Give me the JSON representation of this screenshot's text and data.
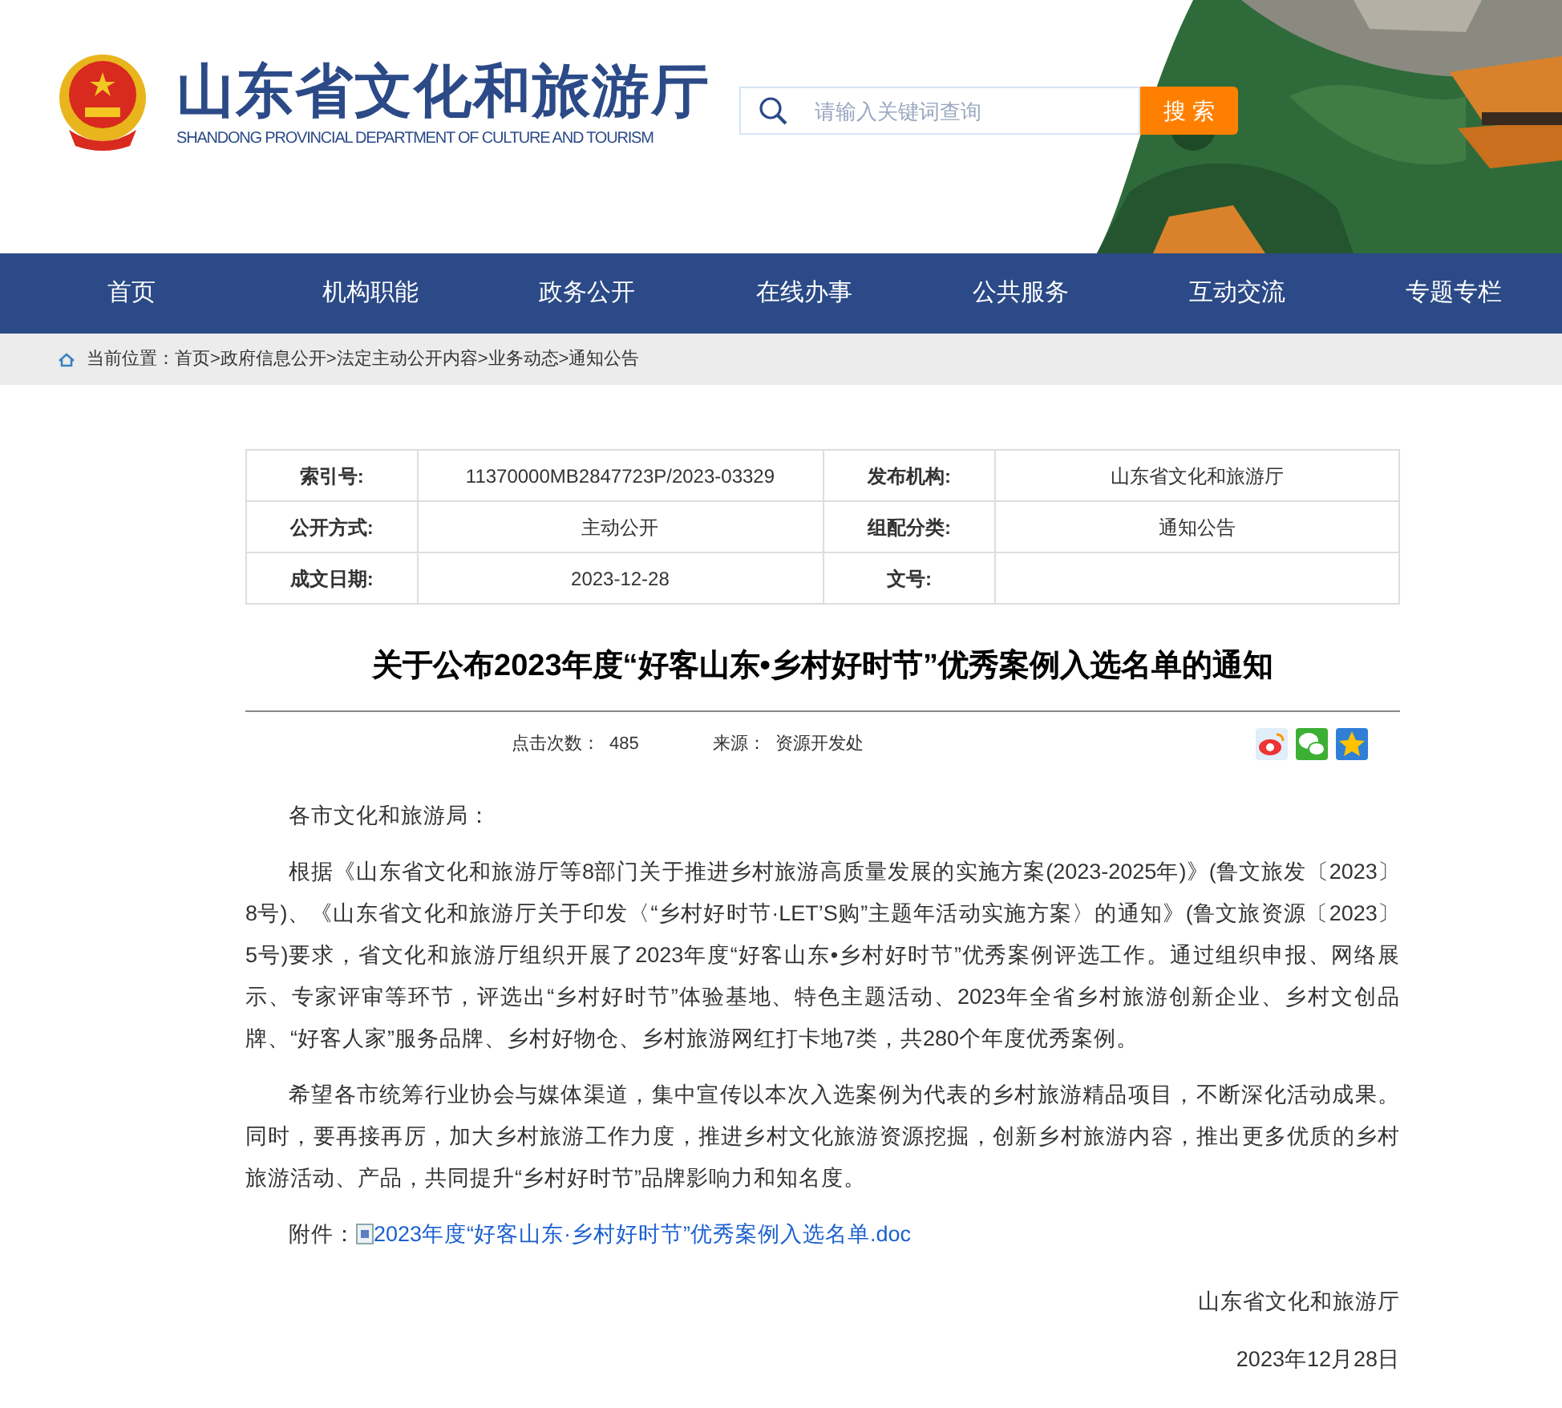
{
  "header": {
    "title": "山东省文化和旅游厅",
    "subtitle": "SHANDONG PROVINCIAL DEPARTMENT OF CULTURE AND TOURISM",
    "search": {
      "placeholder": "请输入关键词查询",
      "button": "搜 索"
    }
  },
  "nav": {
    "items": [
      {
        "label": "首页"
      },
      {
        "label": "机构职能"
      },
      {
        "label": "政务公开"
      },
      {
        "label": "在线办事"
      },
      {
        "label": "公共服务"
      },
      {
        "label": "互动交流"
      },
      {
        "label": "专题专栏"
      }
    ]
  },
  "breadcrumb": {
    "label": "当前位置：",
    "path": "首页>政府信息公开>法定主动公开内容>业务动态>通知公告"
  },
  "info_table": {
    "rows": [
      [
        {
          "label": "索引号:",
          "value": "11370000MB2847723P/2023-03329"
        },
        {
          "label": "发布机构:",
          "value": "山东省文化和旅游厅"
        }
      ],
      [
        {
          "label": "公开方式:",
          "value": "主动公开"
        },
        {
          "label": "组配分类:",
          "value": "通知公告"
        }
      ],
      [
        {
          "label": "成文日期:",
          "value": "2023-12-28"
        },
        {
          "label": "文号:"
        }
      ]
    ]
  },
  "article": {
    "title": "关于公布2023年度“好客山东•乡村好时节”优秀案例入选名单的通知",
    "meta": {
      "clicks_label": "点击次数：",
      "clicks": "485",
      "source_label": "来源：",
      "source": "资源开发处"
    },
    "salutation": "各市文化和旅游局：",
    "paragraphs": [
      "根据《山东省文化和旅游厅等8部门关于推进乡村旅游高质量发展的实施方案(2023-2025年)》(鲁文旅发〔2023〕8号)、《山东省文化和旅游厅关于印发〈“乡村好时节·LET’S购”主题年活动实施方案〉的通知》(鲁文旅资源〔2023〕5号)要求，省文化和旅游厅组织开展了2023年度“好客山东•乡村好时节”优秀案例评选工作。通过组织申报、网络展示、专家评审等环节，评选出“乡村好时节”体验基地、特色主题活动、2023年全省乡村旅游创新企业、乡村文创品牌、“好客人家”服务品牌、乡村好物仓、乡村旅游网红打卡地7类，共280个年度优秀案例。",
      "希望各市统筹行业协会与媒体渠道，集中宣传以本次入选案例为代表的乡村旅游精品项目，不断深化活动成果。同时，要再接再厉，加大乡村旅游工作力度，推进乡村文化旅游资源挖掘，创新乡村旅游内容，推出更多优质的乡村旅游活动、产品，共同提升“乡村好时节”品牌影响力和知名度。"
    ],
    "attachment": {
      "label": "附件：",
      "link": "2023年度“好客山东·乡村好时节”优秀案例入选名单.doc"
    },
    "signature": {
      "org": "山东省文化和旅游厅",
      "date": "2023年12月28日"
    }
  }
}
